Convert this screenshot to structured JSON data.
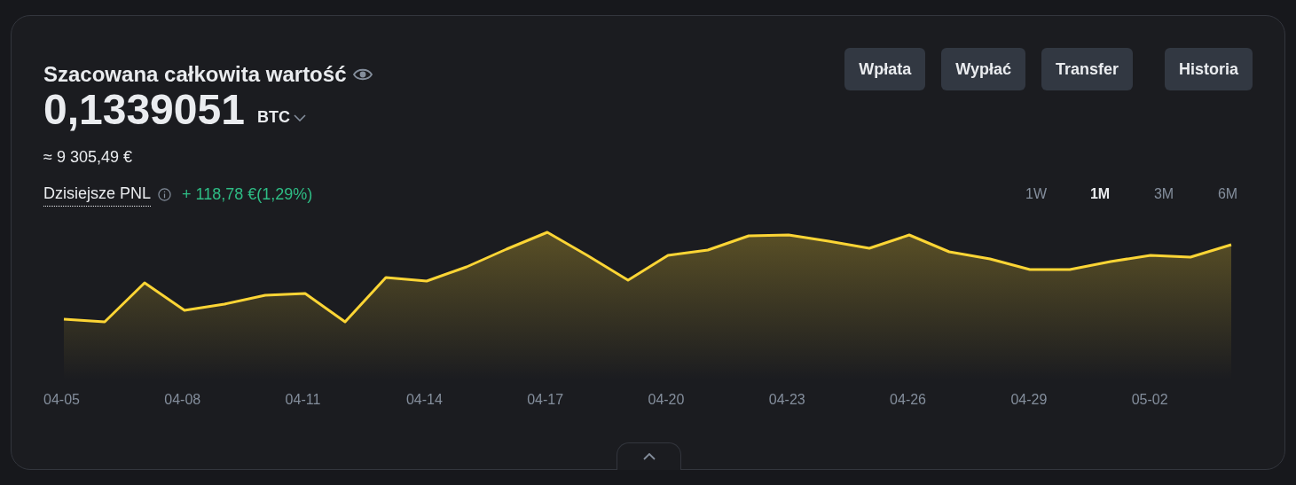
{
  "title": "Szacowana całkowita wartość",
  "balance": {
    "amount": "0,1339051",
    "currency": "BTC",
    "converted": "≈ 9 305,49 €"
  },
  "pnl": {
    "label": "Dzisiejsze PNL",
    "value": "+ 118,78 €(1,29%)"
  },
  "buttons": [
    "Wpłata",
    "Wypłać",
    "Transfer",
    "Historia"
  ],
  "periods": [
    {
      "label": "1W",
      "selected": false
    },
    {
      "label": "1M",
      "selected": true
    },
    {
      "label": "3M",
      "selected": false
    },
    {
      "label": "6M",
      "selected": false
    }
  ],
  "x_labels": [
    "04-05",
    "04-08",
    "04-11",
    "04-14",
    "04-17",
    "04-20",
    "04-23",
    "04-26",
    "04-29",
    "05-02"
  ]
}
